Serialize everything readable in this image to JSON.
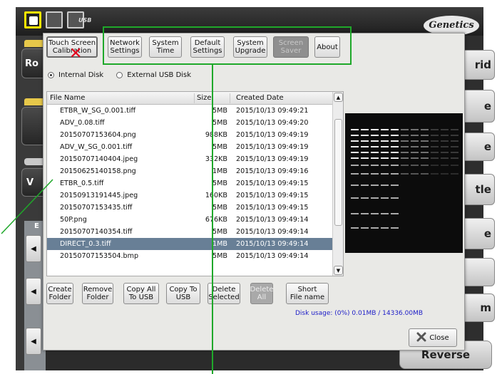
{
  "app": {
    "toolbar_usb_label": "USB",
    "brand": "Genetics",
    "left_button_labels": [
      "Ro",
      "",
      "",
      "V",
      "",
      ""
    ],
    "left_group_label": "E",
    "arrow": "◀",
    "right_button_labels": [
      "rid",
      "e",
      "e",
      "tle",
      "e",
      "",
      "m"
    ],
    "bottom_right_label": "Reverse"
  },
  "tabs": [
    {
      "label": "Touch Screen\nCalibration",
      "disabled": false
    },
    {
      "label": "Network\nSettings",
      "disabled": false
    },
    {
      "label": "System\nTime",
      "disabled": false
    },
    {
      "label": "Default\nSettings",
      "disabled": false
    },
    {
      "label": "System\nUpgrade",
      "disabled": false
    },
    {
      "label": "Screen\nSaver",
      "disabled": true
    },
    {
      "label": "About",
      "disabled": false
    }
  ],
  "calibration_mark": "✕",
  "disk_source": {
    "internal_label": "Internal Disk",
    "external_label": "External USB Disk",
    "selected": "internal"
  },
  "file_table": {
    "columns": [
      "File Name",
      "Size",
      "Created Date"
    ],
    "rows": [
      {
        "name": "ETBR_W_SG_0.001.tiff",
        "size": "5MB",
        "date": "2015/10/13 09:49:21"
      },
      {
        "name": "ADV_0.08.tiff",
        "size": "5MB",
        "date": "2015/10/13 09:49:20"
      },
      {
        "name": "20150707153604.png",
        "size": "988KB",
        "date": "2015/10/13 09:49:19"
      },
      {
        "name": "ADV_W_SG_0.001.tiff",
        "size": "5MB",
        "date": "2015/10/13 09:49:19"
      },
      {
        "name": "20150707140404.jpeg",
        "size": "332KB",
        "date": "2015/10/13 09:49:19"
      },
      {
        "name": "20150625140158.png",
        "size": "1MB",
        "date": "2015/10/13 09:49:16"
      },
      {
        "name": "ETBR_0.5.tiff",
        "size": "5MB",
        "date": "2015/10/13 09:49:15"
      },
      {
        "name": "20150913191445.jpeg",
        "size": "160KB",
        "date": "2015/10/13 09:49:15"
      },
      {
        "name": "20150707153435.tiff",
        "size": "5MB",
        "date": "2015/10/13 09:49:15"
      },
      {
        "name": "50P.png",
        "size": "676KB",
        "date": "2015/10/13 09:49:14"
      },
      {
        "name": "20150707140354.tiff",
        "size": "5MB",
        "date": "2015/10/13 09:49:14"
      },
      {
        "name": "DIRECT_0.3.tiff",
        "size": "1MB",
        "date": "2015/10/13 09:49:14",
        "selected": true
      },
      {
        "name": "20150707153504.bmp",
        "size": "5MB",
        "date": "2015/10/13 09:49:14"
      }
    ]
  },
  "actions": [
    {
      "label": "Create\nFolder",
      "disabled": false
    },
    {
      "label": "Remove\nFolder",
      "disabled": false
    },
    {
      "label": "Copy All\nTo USB",
      "disabled": false
    },
    {
      "label": "Copy To\nUSB",
      "disabled": false
    },
    {
      "label": "Delete\nSelected",
      "disabled": false
    },
    {
      "label": "Delete\nAll",
      "disabled": true
    },
    {
      "label": "Short\nFile name",
      "disabled": false
    }
  ],
  "disk_usage": "Disk usage: (0%) 0.01MB / 14336.00MB",
  "close_label": "Close",
  "colors": {
    "highlight": "#1fa82a",
    "selected_row": "#687f96",
    "disk_usage_text": "#2020c8",
    "mark": "#e3001b"
  }
}
